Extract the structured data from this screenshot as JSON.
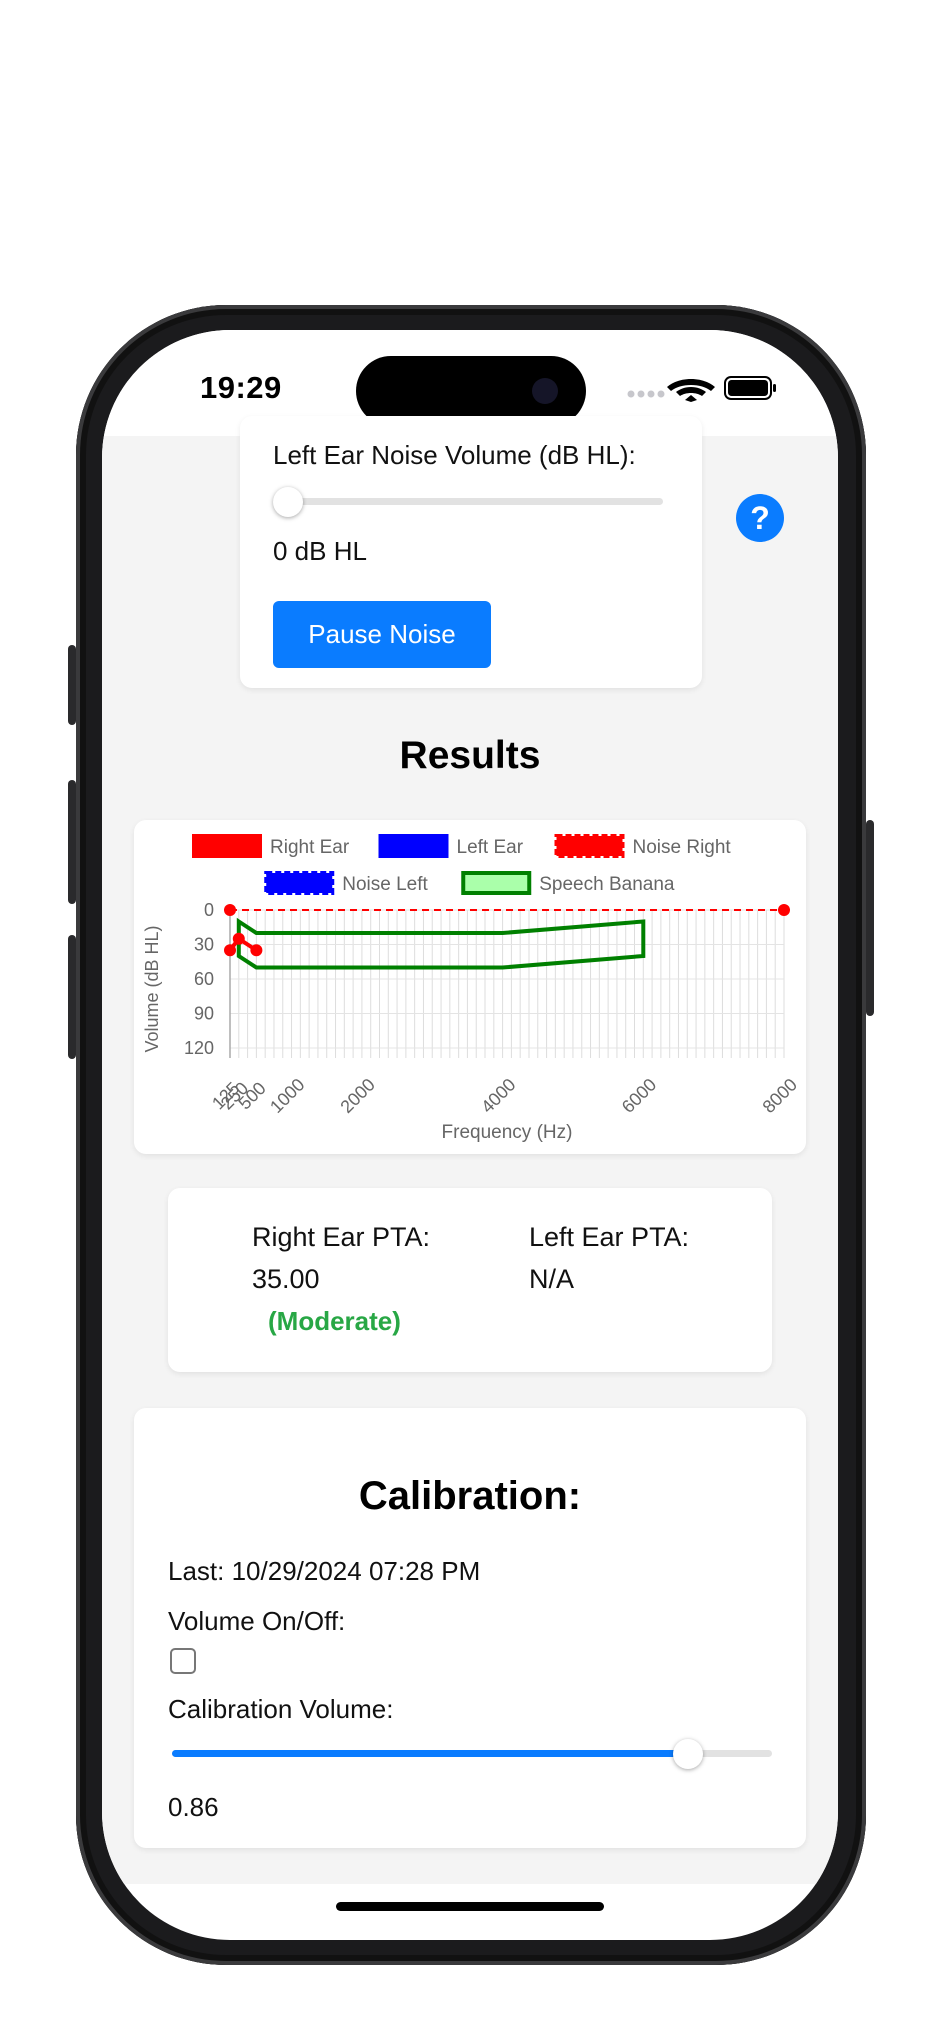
{
  "status_bar": {
    "time": "19:29"
  },
  "noise_panel": {
    "volume_label": "Left Ear Noise Volume (dB HL):",
    "volume_value": "0 dB HL",
    "volume_level": 0,
    "pause_label": "Pause Noise"
  },
  "help": {
    "label": "?"
  },
  "results": {
    "title": "Results"
  },
  "chart_data": {
    "type": "line",
    "xlabel": "Frequency (Hz)",
    "ylabel": "Volume (dB HL)",
    "x_ticks": [
      "125",
      "250",
      "500",
      "1000",
      "2000",
      "4000",
      "6000",
      "8000"
    ],
    "y_ticks": [
      "0",
      "30",
      "60",
      "90",
      "120"
    ],
    "xlim": [
      125,
      8000
    ],
    "ylim": [
      0,
      120
    ],
    "y_inverted": true,
    "legend": [
      {
        "name": "Right Ear",
        "color": "#ff0000",
        "style": "solid"
      },
      {
        "name": "Left Ear",
        "color": "#0000ff",
        "style": "solid"
      },
      {
        "name": "Noise Right",
        "color": "#ff0000",
        "style": "dashed"
      },
      {
        "name": "Noise Left",
        "color": "#0000ff",
        "style": "dashed"
      },
      {
        "name": "Speech Banana",
        "color": "#008000",
        "fill": "#aaffaa",
        "style": "outline"
      }
    ],
    "series": [
      {
        "name": "Right Ear",
        "color": "#ff0000",
        "x": [
          125,
          250,
          500
        ],
        "y": [
          35,
          25,
          35
        ]
      },
      {
        "name": "Noise Right",
        "color": "#ff0000",
        "dashed": true,
        "x": [
          125,
          8000
        ],
        "y": [
          0,
          0
        ]
      }
    ],
    "speech_banana": {
      "x": [
        250,
        500,
        4000,
        6000,
        6000,
        4000,
        500,
        250
      ],
      "y": [
        10,
        20,
        20,
        10,
        40,
        50,
        50,
        40
      ]
    }
  },
  "pta": {
    "right_label": "Right Ear PTA:",
    "right_value": "35.00",
    "right_category": "(Moderate)",
    "left_label": "Left Ear PTA:",
    "left_value": "N/A"
  },
  "calibration": {
    "title": "Calibration:",
    "last": "Last: 10/29/2024 07:28 PM",
    "volume_toggle_label": "Volume On/Off:",
    "volume_toggle_checked": false,
    "volume_label": "Calibration Volume:",
    "volume_value": "0.86",
    "volume_level": 0.86
  }
}
